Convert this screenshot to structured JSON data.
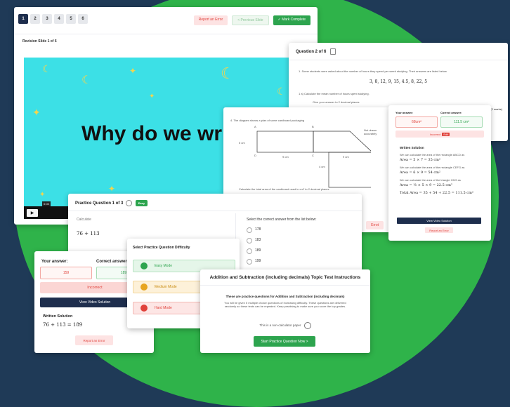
{
  "slide": {
    "tabs": [
      "1",
      "2",
      "3",
      "4",
      "5",
      "6"
    ],
    "report_label": "Report an Error",
    "previous_label": "< Previous Slide",
    "complete_label": "✓ Mark Complete",
    "subtitle": "Revision Slide 1 of 6",
    "video_title": "Why do we writ",
    "video_time": "0:03"
  },
  "question": {
    "header": "Question 2 of 6",
    "intro": "1.   Some students were asked about the number of hours they spend per week studying. Their answers are listed below",
    "data_line": "3, 8, 12, 9, 15, 4.5, 8, 22, 5",
    "part": "1 a)   Calculate the mean number of hours spent studying.",
    "instruction": "Give your answer to 2 decimal places",
    "marks": "(2 marks)"
  },
  "diagram": {
    "intro": "4.   The diagram shows a plan of some cardboard packaging",
    "not_drawn": "Not drawn accurately",
    "labels": [
      "A",
      "B",
      "C",
      "D",
      "E",
      "F",
      "G"
    ],
    "dims": [
      "5 cm",
      "9 cm",
      "6 cm",
      "4 cm",
      "9 cm"
    ],
    "task": "Calculate the total area of the cardboard used in cm² to 2 decimal places",
    "report": "Errot"
  },
  "answer": {
    "your_label": "Your answer:",
    "correct_label": "Correct answer:",
    "your_value": "68cm²",
    "correct_value": "111.5 cm²",
    "status": "Incorrect",
    "status_badge": "Edit",
    "solution_title": "Written Solution",
    "lines": [
      "We can calculate the area of the rectangle ABCD as",
      "Area = 5 × 7 = 35 cm²",
      "We can calculate the area of the rectangle CEFG as",
      "Area = 6 × 9 = 54 cm²",
      "We can calculate the area of the triangle CDG as",
      "Area = ½ × 5 × 9 = 22.5 cm²",
      "Total Area = 35 + 54 + 22.5 = 111.5 cm²"
    ],
    "video_btn": "View Video Solution",
    "report_btn": "Report an Error"
  },
  "practice": {
    "header": "Practice Question 1 of 3",
    "badge": "Easy",
    "calc_label": "Calculate",
    "expr": "76 + 113",
    "select_label": "Select the correct answer from the list below:",
    "options": [
      "178",
      "183",
      "189",
      "199"
    ]
  },
  "incorrect": {
    "your_label": "Your answer:",
    "correct_label": "Correct answer:",
    "your_value": "159",
    "correct_value": "189",
    "status": "Incorrect",
    "video_btn": "View Video Solution",
    "solution_title": "Written Solution",
    "solution": "76 + 113 = 189",
    "report_btn": "Report an Error"
  },
  "difficulty": {
    "title": "Select Practice Question Difficulty",
    "modes": [
      "Easy Mode",
      "Medium Mode",
      "Hard Mode"
    ]
  },
  "instructions": {
    "title": "Addition and Subtraction (including decimals) Topic Test Instructions",
    "bold": "These are practice questions for Addition and Subtraction (including decimals)",
    "body": "You will be given 5 multiple choice questions of increasing difficulty. These questions are delivered randomly so these tests can be repeated. Keep practising to make sure you score the top grades.",
    "calc_note": "This is a non-calculator paper",
    "start_btn": "Start Practice Question Now  >"
  },
  "colors": {
    "background": "#1f3a57",
    "blob": "#2fb34a",
    "accent": "#2da44e",
    "error": "#e0413a",
    "navy": "#1e2e4d"
  }
}
